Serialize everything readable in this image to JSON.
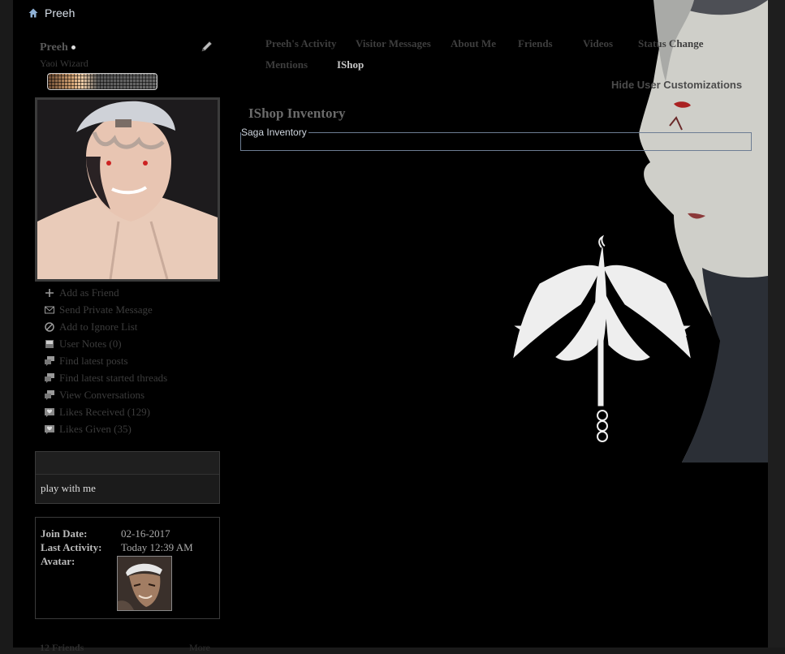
{
  "breadcrumb": {
    "label": "Preeh"
  },
  "profile": {
    "username": "Preeh",
    "user_title": "Yaoi Wizard"
  },
  "tabs": [
    {
      "label": "Preeh's Activity"
    },
    {
      "label": "Visitor Messages"
    },
    {
      "label": "About Me"
    },
    {
      "label": "Friends"
    },
    {
      "label": "Videos"
    },
    {
      "label": "Status Change"
    },
    {
      "label": "Mentions"
    },
    {
      "label": "IShop"
    }
  ],
  "active_tab": "IShop",
  "hide_customizations": "Hide User Customizations",
  "section": {
    "title": "IShop Inventory",
    "legend": "Saga Inventory"
  },
  "actions": [
    {
      "label": "Add as Friend",
      "icon": "plus-icon"
    },
    {
      "label": "Send Private Message",
      "icon": "envelope-icon"
    },
    {
      "label": "Add to Ignore List",
      "icon": "block-icon"
    },
    {
      "label": "User Notes (0)",
      "icon": "notes-icon"
    },
    {
      "label": "Find latest posts",
      "icon": "speech-bubbles-icon"
    },
    {
      "label": "Find latest started threads",
      "icon": "speech-bubbles-icon"
    },
    {
      "label": "View Conversations",
      "icon": "speech-bubbles-icon"
    },
    {
      "label": "Likes Received (129)",
      "icon": "likes-icon"
    },
    {
      "label": "Likes Given (35)",
      "icon": "likes-icon"
    }
  ],
  "status": {
    "text": "play with me"
  },
  "info": {
    "join_label": "Join Date:",
    "join_value": "02-16-2017",
    "activity_label": "Last Activity:",
    "activity_value": "Today 12:39 AM",
    "avatar_label": "Avatar:"
  },
  "friends_peek": {
    "label": "12 Friends",
    "more": "More"
  }
}
